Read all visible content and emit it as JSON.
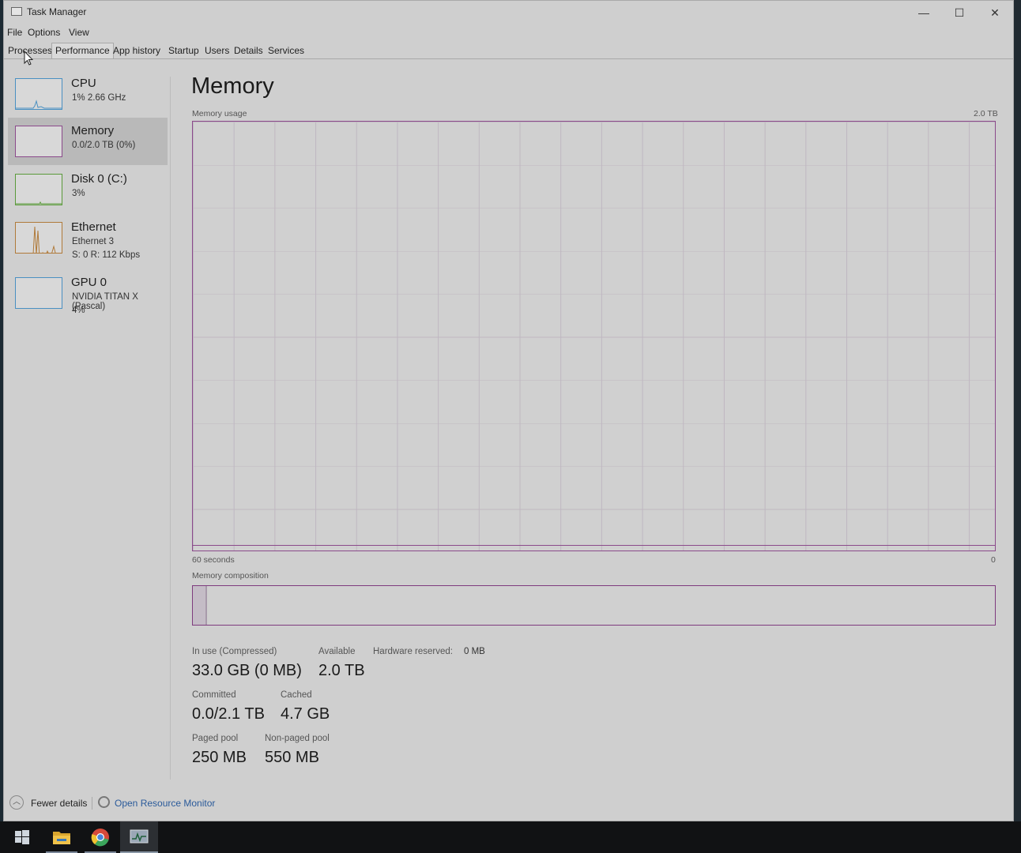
{
  "window": {
    "title": "Task Manager",
    "controls": {
      "minimize": "—",
      "maximize": "☐",
      "close": "✕"
    }
  },
  "menu": [
    "File",
    "Options",
    "View"
  ],
  "tabs": [
    "Processes",
    "Performance",
    "App history",
    "Startup",
    "Users",
    "Details",
    "Services"
  ],
  "active_tab": "Performance",
  "sidebar": {
    "items": [
      {
        "name": "CPU",
        "sub": "1%  2.66 GHz",
        "sub2": "",
        "color": "#4a90c2"
      },
      {
        "name": "Memory",
        "sub": "0.0/2.0 TB (0%)",
        "sub2": "",
        "color": "#8b4a8b"
      },
      {
        "name": "Disk 0 (C:)",
        "sub": "3%",
        "sub2": "",
        "color": "#5a9a3a"
      },
      {
        "name": "Ethernet",
        "sub": "Ethernet 3",
        "sub2": "S: 0  R: 112 Kbps",
        "color": "#b07a3a"
      },
      {
        "name": "GPU 0",
        "sub": "NVIDIA TITAN X (Pascal)",
        "sub2": "4%",
        "color": "#4a90c2"
      }
    ]
  },
  "main": {
    "title": "Memory",
    "usage_label": "Memory usage",
    "usage_max": "2.0 TB",
    "time_left": "60 seconds",
    "time_right": "0",
    "composition_label": "Memory composition",
    "stats": {
      "in_use_label": "In use (Compressed)",
      "in_use_value": "33.0 GB (0 MB)",
      "available_label": "Available",
      "available_value": "2.0 TB",
      "hw_reserved_label": "Hardware reserved:",
      "hw_reserved_value": "0 MB",
      "committed_label": "Committed",
      "committed_value": "0.0/2.1 TB",
      "cached_label": "Cached",
      "cached_value": "4.7 GB",
      "paged_label": "Paged pool",
      "paged_value": "250 MB",
      "nonpaged_label": "Non-paged pool",
      "nonpaged_value": "550 MB"
    }
  },
  "footer": {
    "fewer_details": "Fewer details",
    "open_resource_monitor": "Open Resource Monitor"
  },
  "taskbar": {
    "items": [
      "start-icon",
      "file-explorer-icon",
      "chrome-icon",
      "task-manager-icon"
    ]
  }
}
